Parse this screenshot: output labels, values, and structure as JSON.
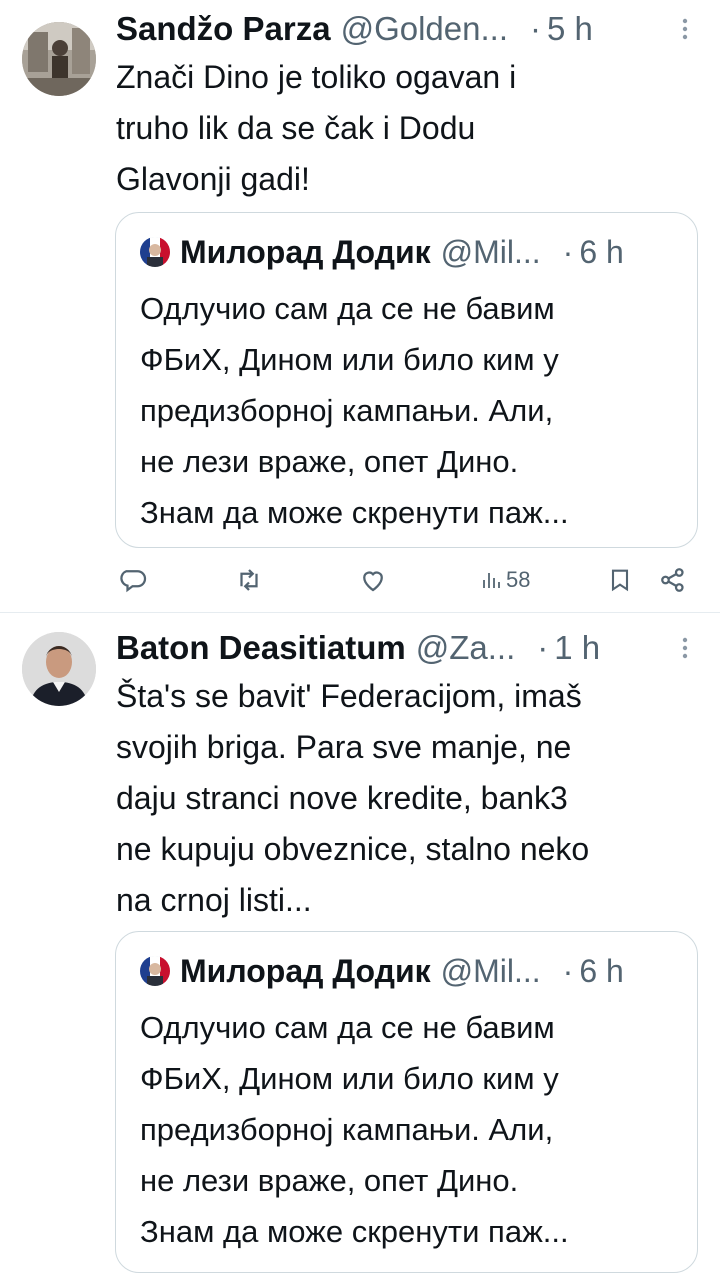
{
  "tweets": [
    {
      "name": "Sandžo Parza",
      "handle": "@Golden...",
      "separator": "·",
      "time": "5 h",
      "more_icon": "more-vertical-icon",
      "text_lines": [
        "Znači Dino je toliko ogavan i",
        "truho lik da se čak i Dodu",
        "Glavonji gadi!"
      ],
      "quote": {
        "name": "Милорад Додик",
        "handle": "@Mil...",
        "separator": "·",
        "time": "6 h",
        "text_lines": [
          "Одлучио сам да се не бавим",
          "ФБиХ, Дином или било ким у",
          "предизборној кампањи. Али,",
          "не лези враже, опет Дино.",
          "Знам да може скренути паж..."
        ]
      },
      "actions": {
        "reply_icon": "reply-icon",
        "retweet_icon": "retweet-icon",
        "like_icon": "like-icon",
        "views_icon": "views-icon",
        "views_count": "58",
        "bookmark_icon": "bookmark-icon",
        "share_icon": "share-icon"
      }
    },
    {
      "name": "Baton Deasitiatum",
      "handle": "@Za...",
      "separator": "·",
      "time": "1 h",
      "more_icon": "more-vertical-icon",
      "text_lines": [
        "Šta's se bavit' Federacijom, imaš",
        "svojih briga. Para sve manje, ne",
        "daju stranci nove kredite, bank3",
        "ne kupuju obveznice, stalno neko",
        "na crnoj listi..."
      ],
      "quote": {
        "name": "Милорад Додик",
        "handle": "@Mil...",
        "separator": "·",
        "time": "6 h",
        "text_lines": [
          "Одлучио сам да се не бавим",
          "ФБиХ, Дином или било ким у",
          "предизборној кампањи. Али,",
          "не лези враже, опет Дино.",
          "Знам да може скренути паж..."
        ]
      }
    }
  ],
  "colors": {
    "text": "#0f1419",
    "secondary": "#536471",
    "border": "#cfd9de",
    "divider": "#e6ecf0"
  }
}
